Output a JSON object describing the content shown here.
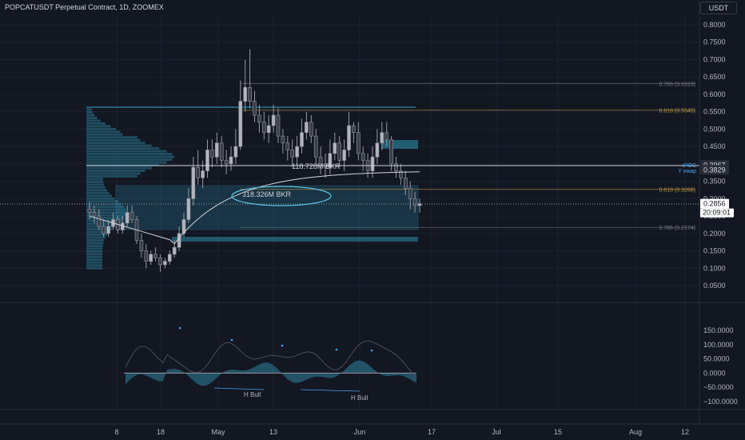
{
  "header": {
    "title": "POPCATUSDT Perpetual Contract, 1D, ZOOMEX",
    "currency": "USDT"
  },
  "colors": {
    "background": "#131722",
    "candle": "#9598a1",
    "fib_gray": "#787b86",
    "fib_gold": "#b8943e",
    "vwap": "#d1d4dc",
    "zone": "#2b8ca8",
    "volume_profile": "#2b7a94",
    "oscillator_fill": "#2b7a94",
    "accent_blue": "#42a5f5"
  },
  "chart_data": [
    {
      "type": "candlestick",
      "x_tick_labels": [
        "8",
        "18",
        "May",
        "13",
        "Jun",
        "17",
        "Jul",
        "15",
        "Aug",
        "12"
      ],
      "y_tick_labels": [
        "0.8000",
        "0.7500",
        "0.7000",
        "0.6500",
        "0.6000",
        "0.5500",
        "0.5000",
        "0.4500",
        "0.4000",
        "0.3500",
        "0.3000",
        "0.2500",
        "0.2000",
        "0.1500",
        "0.1000",
        "0.0500"
      ],
      "ylim": [
        0.0,
        0.82
      ],
      "series": [
        {
          "x": [
            "Apr 1",
            "Apr 2",
            "Apr 3",
            "Apr 4",
            "Apr 5",
            "Apr 6",
            "Apr 7",
            "Apr 8",
            "Apr 9",
            "Apr 10",
            "Apr 11",
            "Apr 12",
            "Apr 13",
            "Apr 14",
            "Apr 15",
            "Apr 16",
            "Apr 17",
            "Apr 18",
            "Apr 19",
            "Apr 20",
            "Apr 21",
            "Apr 22",
            "Apr 23",
            "Apr 24",
            "Apr 25",
            "Apr 26",
            "Apr 27",
            "Apr 28",
            "Apr 29",
            "Apr 30",
            "May 1",
            "May 2",
            "May 3",
            "May 4",
            "May 5",
            "May 6",
            "May 7",
            "May 8",
            "May 9",
            "May 10",
            "May 11",
            "May 12",
            "May 13",
            "May 14",
            "May 15",
            "May 16",
            "May 17",
            "May 18",
            "May 19",
            "May 20",
            "May 21",
            "May 22",
            "May 23",
            "May 24",
            "May 25",
            "May 26",
            "May 27",
            "May 28",
            "May 29",
            "May 30",
            "May 31",
            "Jun 1",
            "Jun 2",
            "Jun 3",
            "Jun 4",
            "Jun 5",
            "Jun 6",
            "Jun 7",
            "Jun 8",
            "Jun 9",
            "Jun 10"
          ],
          "open": [
            0.27,
            0.26,
            0.25,
            0.22,
            0.2,
            0.22,
            0.24,
            0.21,
            0.23,
            0.26,
            0.24,
            0.18,
            0.15,
            0.12,
            0.14,
            0.13,
            0.11,
            0.12,
            0.14,
            0.16,
            0.2,
            0.24,
            0.3,
            0.39,
            0.36,
            0.38,
            0.44,
            0.42,
            0.46,
            0.41,
            0.4,
            0.42,
            0.45,
            0.58,
            0.62,
            0.58,
            0.54,
            0.52,
            0.49,
            0.51,
            0.54,
            0.48,
            0.46,
            0.44,
            0.42,
            0.45,
            0.49,
            0.52,
            0.48,
            0.42,
            0.4,
            0.39,
            0.43,
            0.46,
            0.41,
            0.44,
            0.51,
            0.49,
            0.43,
            0.41,
            0.38,
            0.42,
            0.46,
            0.49,
            0.47,
            0.4,
            0.38,
            0.36,
            0.33,
            0.3,
            0.28
          ],
          "close": [
            0.26,
            0.25,
            0.22,
            0.2,
            0.22,
            0.24,
            0.21,
            0.23,
            0.26,
            0.24,
            0.18,
            0.15,
            0.12,
            0.14,
            0.13,
            0.11,
            0.12,
            0.14,
            0.16,
            0.2,
            0.24,
            0.3,
            0.39,
            0.36,
            0.38,
            0.44,
            0.42,
            0.46,
            0.41,
            0.4,
            0.42,
            0.45,
            0.58,
            0.62,
            0.58,
            0.54,
            0.52,
            0.49,
            0.51,
            0.54,
            0.48,
            0.46,
            0.44,
            0.42,
            0.45,
            0.49,
            0.52,
            0.48,
            0.42,
            0.4,
            0.39,
            0.43,
            0.46,
            0.41,
            0.44,
            0.51,
            0.49,
            0.43,
            0.41,
            0.38,
            0.42,
            0.46,
            0.49,
            0.47,
            0.4,
            0.38,
            0.36,
            0.33,
            0.3,
            0.28,
            0.2856
          ],
          "high": [
            0.29,
            0.28,
            0.27,
            0.24,
            0.24,
            0.26,
            0.25,
            0.25,
            0.28,
            0.28,
            0.25,
            0.2,
            0.17,
            0.15,
            0.16,
            0.14,
            0.13,
            0.15,
            0.18,
            0.22,
            0.26,
            0.33,
            0.42,
            0.44,
            0.41,
            0.47,
            0.47,
            0.49,
            0.48,
            0.44,
            0.45,
            0.5,
            0.64,
            0.7,
            0.73,
            0.61,
            0.57,
            0.55,
            0.54,
            0.57,
            0.56,
            0.5,
            0.48,
            0.47,
            0.48,
            0.53,
            0.55,
            0.54,
            0.5,
            0.45,
            0.43,
            0.47,
            0.49,
            0.48,
            0.47,
            0.55,
            0.52,
            0.52,
            0.45,
            0.43,
            0.45,
            0.5,
            0.52,
            0.52,
            0.48,
            0.42,
            0.4,
            0.38,
            0.35,
            0.32,
            0.3
          ],
          "low": [
            0.24,
            0.23,
            0.21,
            0.19,
            0.19,
            0.21,
            0.2,
            0.2,
            0.22,
            0.23,
            0.17,
            0.13,
            0.1,
            0.11,
            0.12,
            0.09,
            0.1,
            0.11,
            0.13,
            0.15,
            0.19,
            0.23,
            0.28,
            0.34,
            0.33,
            0.36,
            0.39,
            0.4,
            0.39,
            0.37,
            0.38,
            0.4,
            0.44,
            0.55,
            0.56,
            0.52,
            0.49,
            0.47,
            0.46,
            0.49,
            0.46,
            0.43,
            0.41,
            0.39,
            0.4,
            0.43,
            0.47,
            0.46,
            0.4,
            0.37,
            0.36,
            0.37,
            0.41,
            0.39,
            0.38,
            0.42,
            0.46,
            0.41,
            0.38,
            0.36,
            0.36,
            0.4,
            0.44,
            0.45,
            0.38,
            0.36,
            0.34,
            0.31,
            0.27,
            0.26,
            0.26
          ]
        }
      ],
      "fib_levels": [
        {
          "label": "0.786 (0.6313)",
          "value": 0.6313,
          "color": "#787b86"
        },
        {
          "label": "0.618 (0.5545)",
          "value": 0.5545,
          "color": "#b8943e"
        },
        {
          "label": "0.618 (0.3268)",
          "value": 0.3268,
          "color": "#b8943e"
        },
        {
          "label": "0.786 (0.2174)",
          "value": 0.2174,
          "color": "#787b86"
        }
      ],
      "annotations": {
        "bkr_top": "118.728M BKR",
        "bkr_bottom": "318.326M BKR",
        "rpoc_label": "rPOC",
        "vwap_label": "Y vwap"
      },
      "price_markers": [
        {
          "label": "0.3967",
          "value": 0.3967,
          "style": "dark"
        },
        {
          "label": "0.3829",
          "value": 0.3829,
          "style": "dark"
        },
        {
          "label": "0.2856",
          "value": 0.2856,
          "style": "light"
        }
      ],
      "countdown": "20:09:01"
    },
    {
      "type": "area",
      "y_tick_labels": [
        "150.0000",
        "100.0000",
        "50.0000",
        "0.0000",
        "−50.0000",
        "−100.0000"
      ],
      "ylim": [
        -125,
        175
      ],
      "divergence_labels": [
        "H Bull",
        "H Bull"
      ]
    }
  ]
}
